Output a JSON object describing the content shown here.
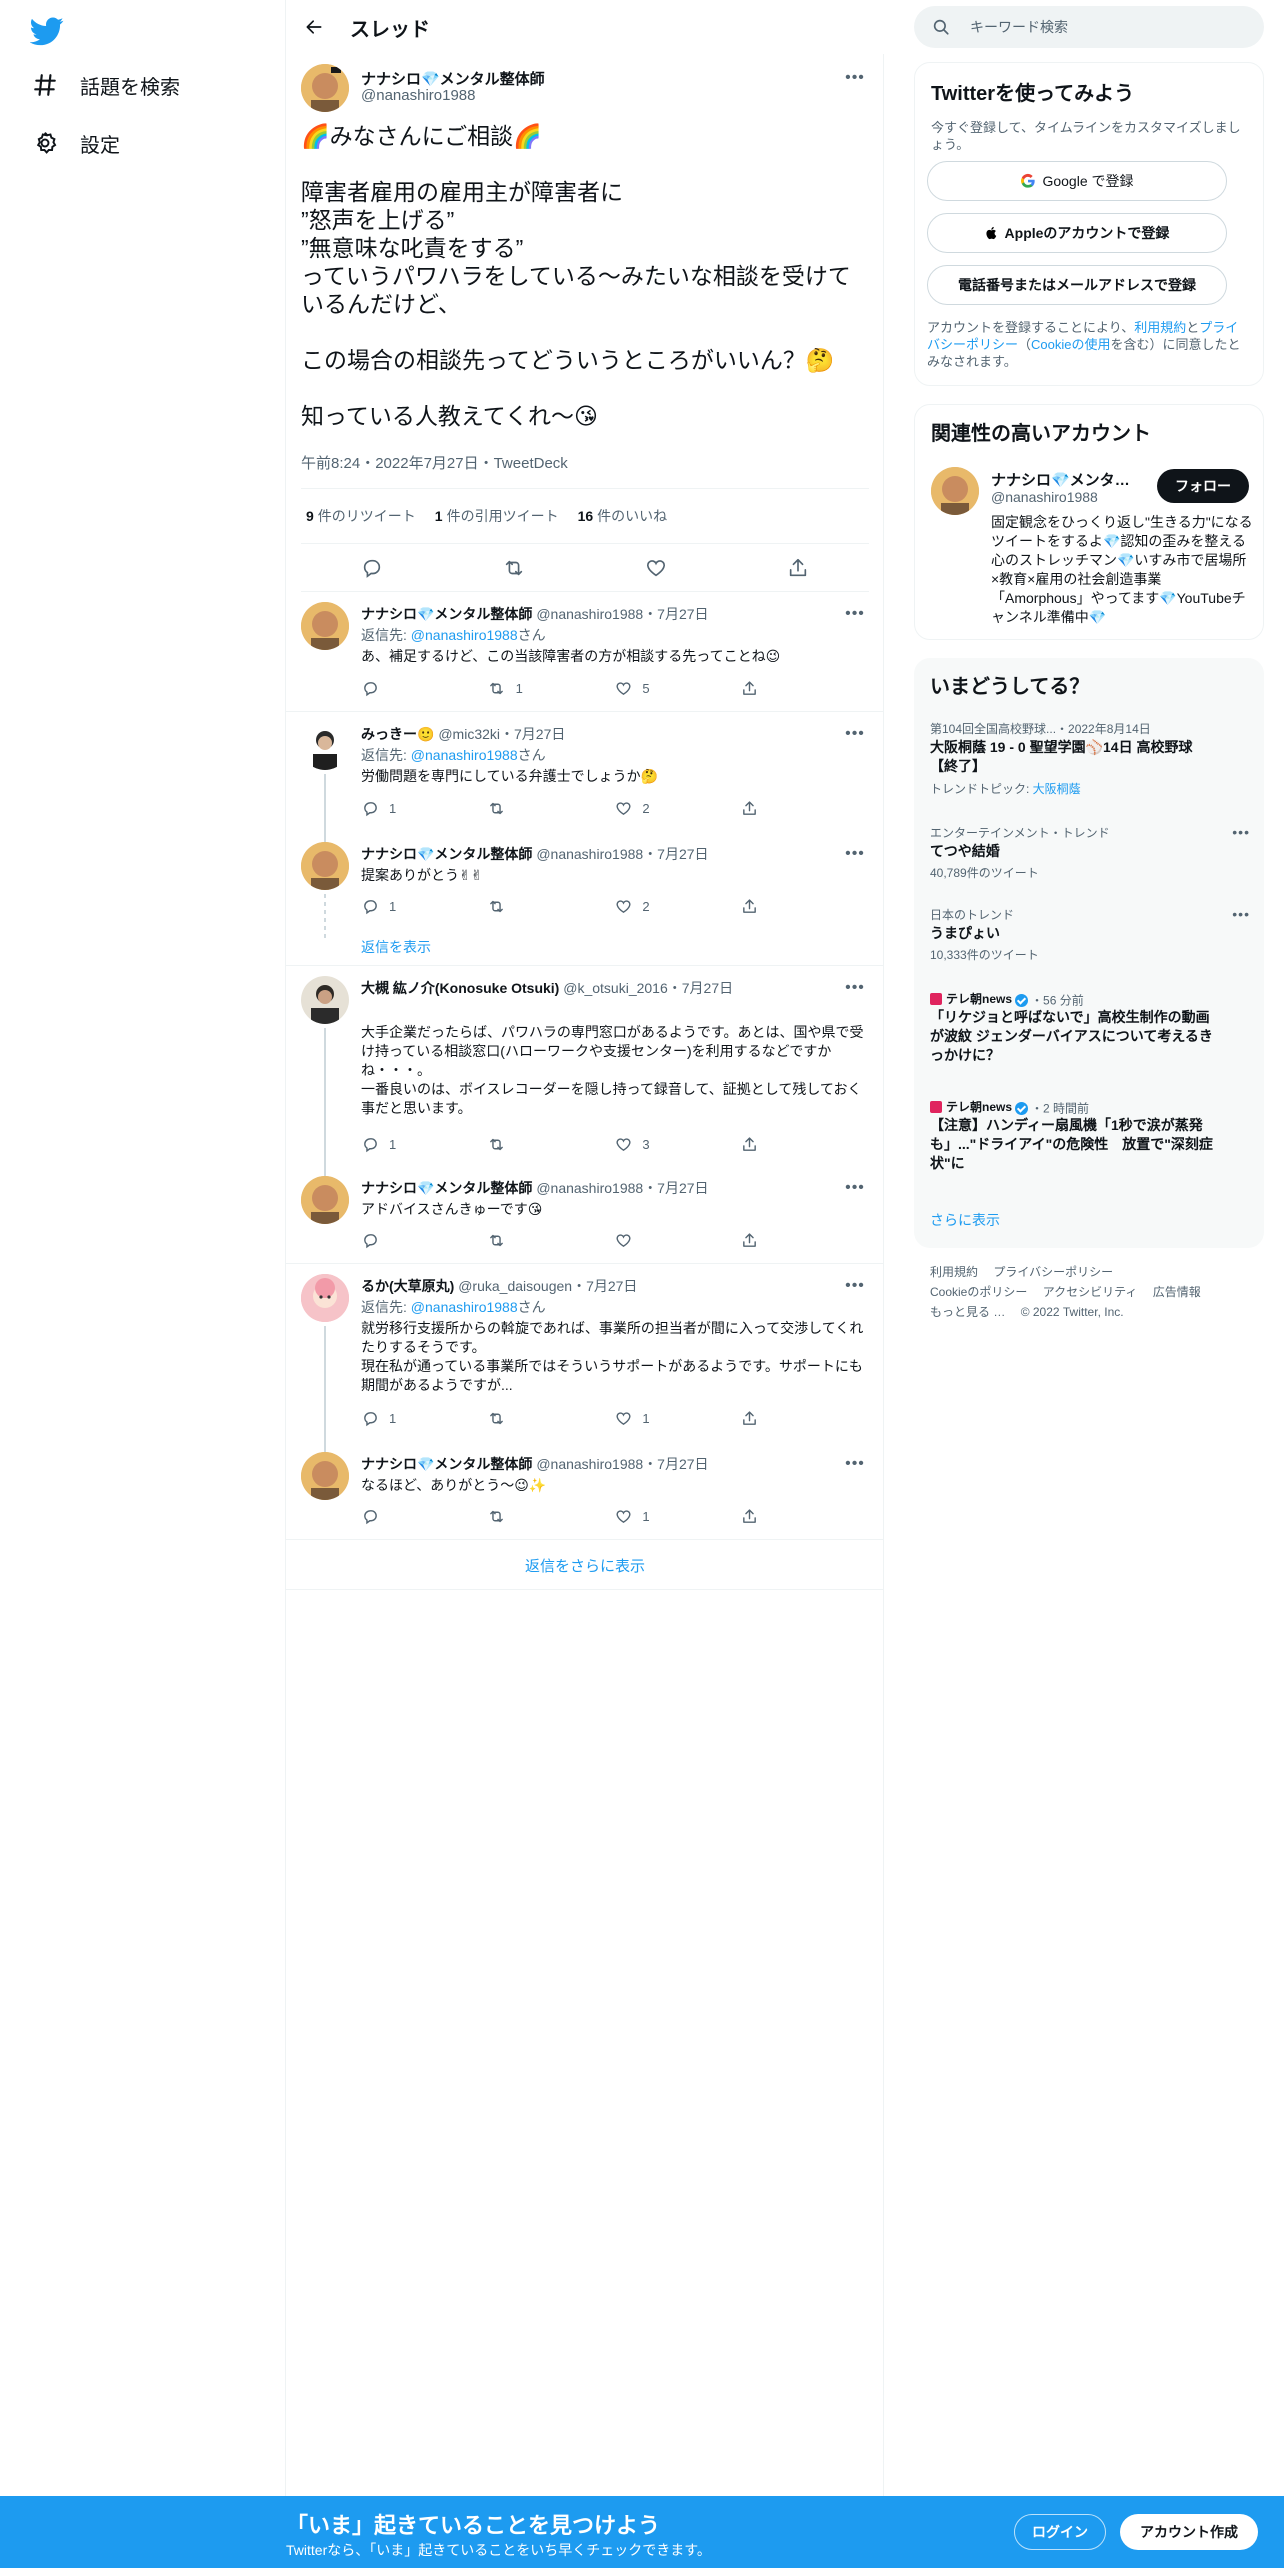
{
  "nav": {
    "explore": "話題を検索",
    "settings": "設定"
  },
  "header": {
    "title": "スレッド"
  },
  "focal": {
    "name": "ナナシロ💎メンタル整体師",
    "handle": "@nanashiro1988",
    "text": "🌈みなさんにご相談🌈\n\n障害者雇用の雇用主が障害者に\n”怒声を上げる”\n”無意味な叱責をする”\nっていうパワハラをしている〜みたいな相談を受けているんだけど、\n\nこの場合の相談先ってどういうところがいいん？🤔\n\n知っている人教えてくれ〜😘",
    "meta": "午前8:24・2022年7月27日・TweetDeck",
    "stats": {
      "retweets_count": "9",
      "retweets_label": "件のリツイート",
      "quotes_count": "1",
      "quotes_label": "件の引用ツイート",
      "likes_count": "16",
      "likes_label": "件のいいね"
    }
  },
  "replies": [
    {
      "name": "ナナシロ💎メンタル整体師",
      "handle": "@nanashiro1988",
      "date": "・7月27日",
      "replyto_prefix": "返信先: ",
      "replyto": "@nanashiro1988",
      "replyto_suffix": "さん",
      "text": "あ、補足するけど、この当該障害者の方が相談する先ってことね😉",
      "reply_count": "",
      "rt_count": "1",
      "like_count": "5"
    },
    {
      "name": "みっきー🙂",
      "handle": "@mic32ki",
      "date": "・7月27日",
      "replyto_prefix": "返信先: ",
      "replyto": "@nanashiro1988",
      "replyto_suffix": "さん",
      "text": "労働問題を専門にしている弁護士でしょうか🤔",
      "reply_count": "1",
      "rt_count": "",
      "like_count": "2"
    },
    {
      "name": "ナナシロ💎メンタル整体師",
      "handle": "@nanashiro1988",
      "date": "・7月27日",
      "text": "提案ありがとう✌✌",
      "reply_count": "1",
      "rt_count": "",
      "like_count": "2"
    },
    {
      "name": "大槻 紘ノ介(Konosuke Otsuki)",
      "handle": "@k_otsuki_2016",
      "date": "・7月27日",
      "text": "大手企業だったらば、パワハラの専門窓口があるようです。あとは、国や県で受け持っている相談窓口(ハローワークや支援センター)を利用するなどですかね・・・。\n一番良いのは、ボイスレコーダーを隠し持って録音して、証拠として残しておく事だと思います。",
      "reply_count": "1",
      "rt_count": "",
      "like_count": "3"
    },
    {
      "name": "ナナシロ💎メンタル整体師",
      "handle": "@nanashiro1988",
      "date": "・7月27日",
      "text": "アドバイスさんきゅーです😘",
      "reply_count": "",
      "rt_count": "",
      "like_count": ""
    },
    {
      "name": "るか(大草原丸)",
      "handle": "@ruka_daisougen",
      "date": "・7月27日",
      "replyto_prefix": "返信先: ",
      "replyto": "@nanashiro1988",
      "replyto_suffix": "さん",
      "text": "就労移行支援所からの斡旋であれば、事業所の担当者が間に入って交渉してくれたりするそうです。\n現在私が通っている事業所ではそういうサポートがあるようです。サポートにも期間があるようですが...",
      "reply_count": "1",
      "rt_count": "",
      "like_count": "1"
    },
    {
      "name": "ナナシロ💎メンタル整体師",
      "handle": "@nanashiro1988",
      "date": "・7月27日",
      "text": "なるほど、ありがとう〜😉✨",
      "reply_count": "",
      "rt_count": "",
      "like_count": "1"
    }
  ],
  "show_replies": "返信を表示",
  "show_more_replies": "返信をさらに表示",
  "search": {
    "placeholder": "キーワード検索"
  },
  "signup": {
    "title": "Twitterを使ってみよう",
    "subtitle": "今すぐ登録して、タイムラインをカスタマイズしましょう。",
    "google": "Google で登録",
    "apple": "Appleのアカウントで登録",
    "phone": "電話番号またはメールアドレスで登録",
    "legal_1": "アカウントを登録することにより、",
    "legal_terms": "利用規約",
    "legal_2": "と",
    "legal_privacy": "プライバシーポリシー",
    "legal_3": "（",
    "legal_cookie": "Cookieの使用",
    "legal_4": "を含む）に同意したとみなされます。"
  },
  "related": {
    "title": "関連性の高いアカウント",
    "name": "ナナシロ💎メンタル整体師",
    "handle": "@nanashiro1988",
    "follow": "フォロー",
    "bio": "固定観念をひっくり返し\"生きる力\"になるツイートをするよ💎認知の歪みを整える心のストレッチマン💎いすみ市で居場所×教育×雇用の社会創造事業「Amorphous」やってます💎YouTubeチャンネル準備中💎"
  },
  "trends": {
    "title": "いまどうしてる？",
    "items": [
      {
        "meta": "第104回全国高校野球...・2022年8月14日",
        "title": "大阪桐蔭 19 - 0 聖望学園⚾14日 高校野球【終了】",
        "sub_prefix": "トレンドトピック: ",
        "sub_link": "大阪桐蔭"
      },
      {
        "meta": "エンターテインメント・トレンド",
        "title": "てつや結婚",
        "sub": "40,789件のツイート"
      },
      {
        "meta": "日本のトレンド",
        "title": "うまぴょい",
        "sub": "10,333件のツイート"
      },
      {
        "source": "テレ朝news",
        "time": "・56 分前",
        "title": "「リケジョと呼ばないで」高校生制作の動画が波紋 ジェンダーバイアスについて考えるきっかけに？"
      },
      {
        "source": "テレ朝news",
        "time": "・2 時間前",
        "title": "【注意】ハンディー扇風機「1秒で涙が蒸発も」...\"ドライアイ\"の危険性　放置で\"深刻症状\"に"
      }
    ],
    "show_more": "さらに表示"
  },
  "footer": [
    "利用規約",
    "プライバシーポリシー",
    "Cookieのポリシー",
    "アクセシビリティ",
    "広告情報",
    "もっと見る …",
    "© 2022 Twitter, Inc."
  ],
  "bottom": {
    "title": "「いま」起きていることを見つけよう",
    "subtitle": "Twitterなら、「いま」起きていることをいち早くチェックできます。",
    "login": "ログイン",
    "signup": "アカウント作成"
  },
  "colors": {
    "accent": "#1d9bf0",
    "text": "#0f1419",
    "muted": "#536471",
    "border": "#eff3f4"
  }
}
